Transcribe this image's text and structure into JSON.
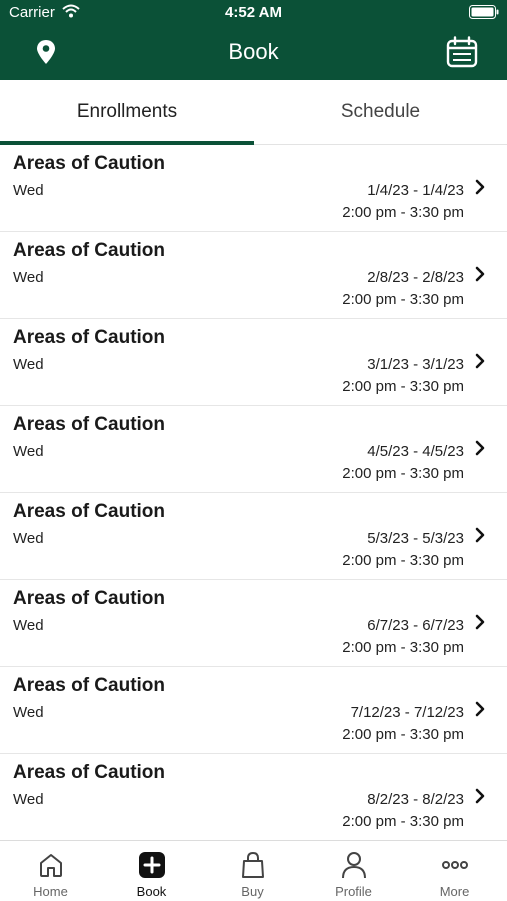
{
  "status": {
    "carrier": "Carrier",
    "time": "4:52 AM"
  },
  "header": {
    "title": "Book"
  },
  "tabs": [
    {
      "label": "Enrollments"
    },
    {
      "label": "Schedule"
    }
  ],
  "enrollments": [
    {
      "title": "Areas of Caution",
      "day": "Wed",
      "dates": "1/4/23 - 1/4/23",
      "times": "2:00 pm - 3:30 pm"
    },
    {
      "title": "Areas of Caution",
      "day": "Wed",
      "dates": "2/8/23 - 2/8/23",
      "times": "2:00 pm - 3:30 pm"
    },
    {
      "title": "Areas of Caution",
      "day": "Wed",
      "dates": "3/1/23 - 3/1/23",
      "times": "2:00 pm - 3:30 pm"
    },
    {
      "title": "Areas of Caution",
      "day": "Wed",
      "dates": "4/5/23 - 4/5/23",
      "times": "2:00 pm - 3:30 pm"
    },
    {
      "title": "Areas of Caution",
      "day": "Wed",
      "dates": "5/3/23 - 5/3/23",
      "times": "2:00 pm - 3:30 pm"
    },
    {
      "title": "Areas of Caution",
      "day": "Wed",
      "dates": "6/7/23 - 6/7/23",
      "times": "2:00 pm - 3:30 pm"
    },
    {
      "title": "Areas of Caution",
      "day": "Wed",
      "dates": "7/12/23 - 7/12/23",
      "times": "2:00 pm - 3:30 pm"
    },
    {
      "title": "Areas of Caution",
      "day": "Wed",
      "dates": "8/2/23 - 8/2/23",
      "times": "2:00 pm - 3:30 pm"
    }
  ],
  "tabbar": [
    {
      "label": "Home",
      "icon": "home-icon"
    },
    {
      "label": "Book",
      "icon": "plus-square-icon"
    },
    {
      "label": "Buy",
      "icon": "shopping-bag-icon"
    },
    {
      "label": "Profile",
      "icon": "person-icon"
    },
    {
      "label": "More",
      "icon": "more-dots-icon"
    }
  ],
  "colors": {
    "brand": "#0b5137"
  }
}
